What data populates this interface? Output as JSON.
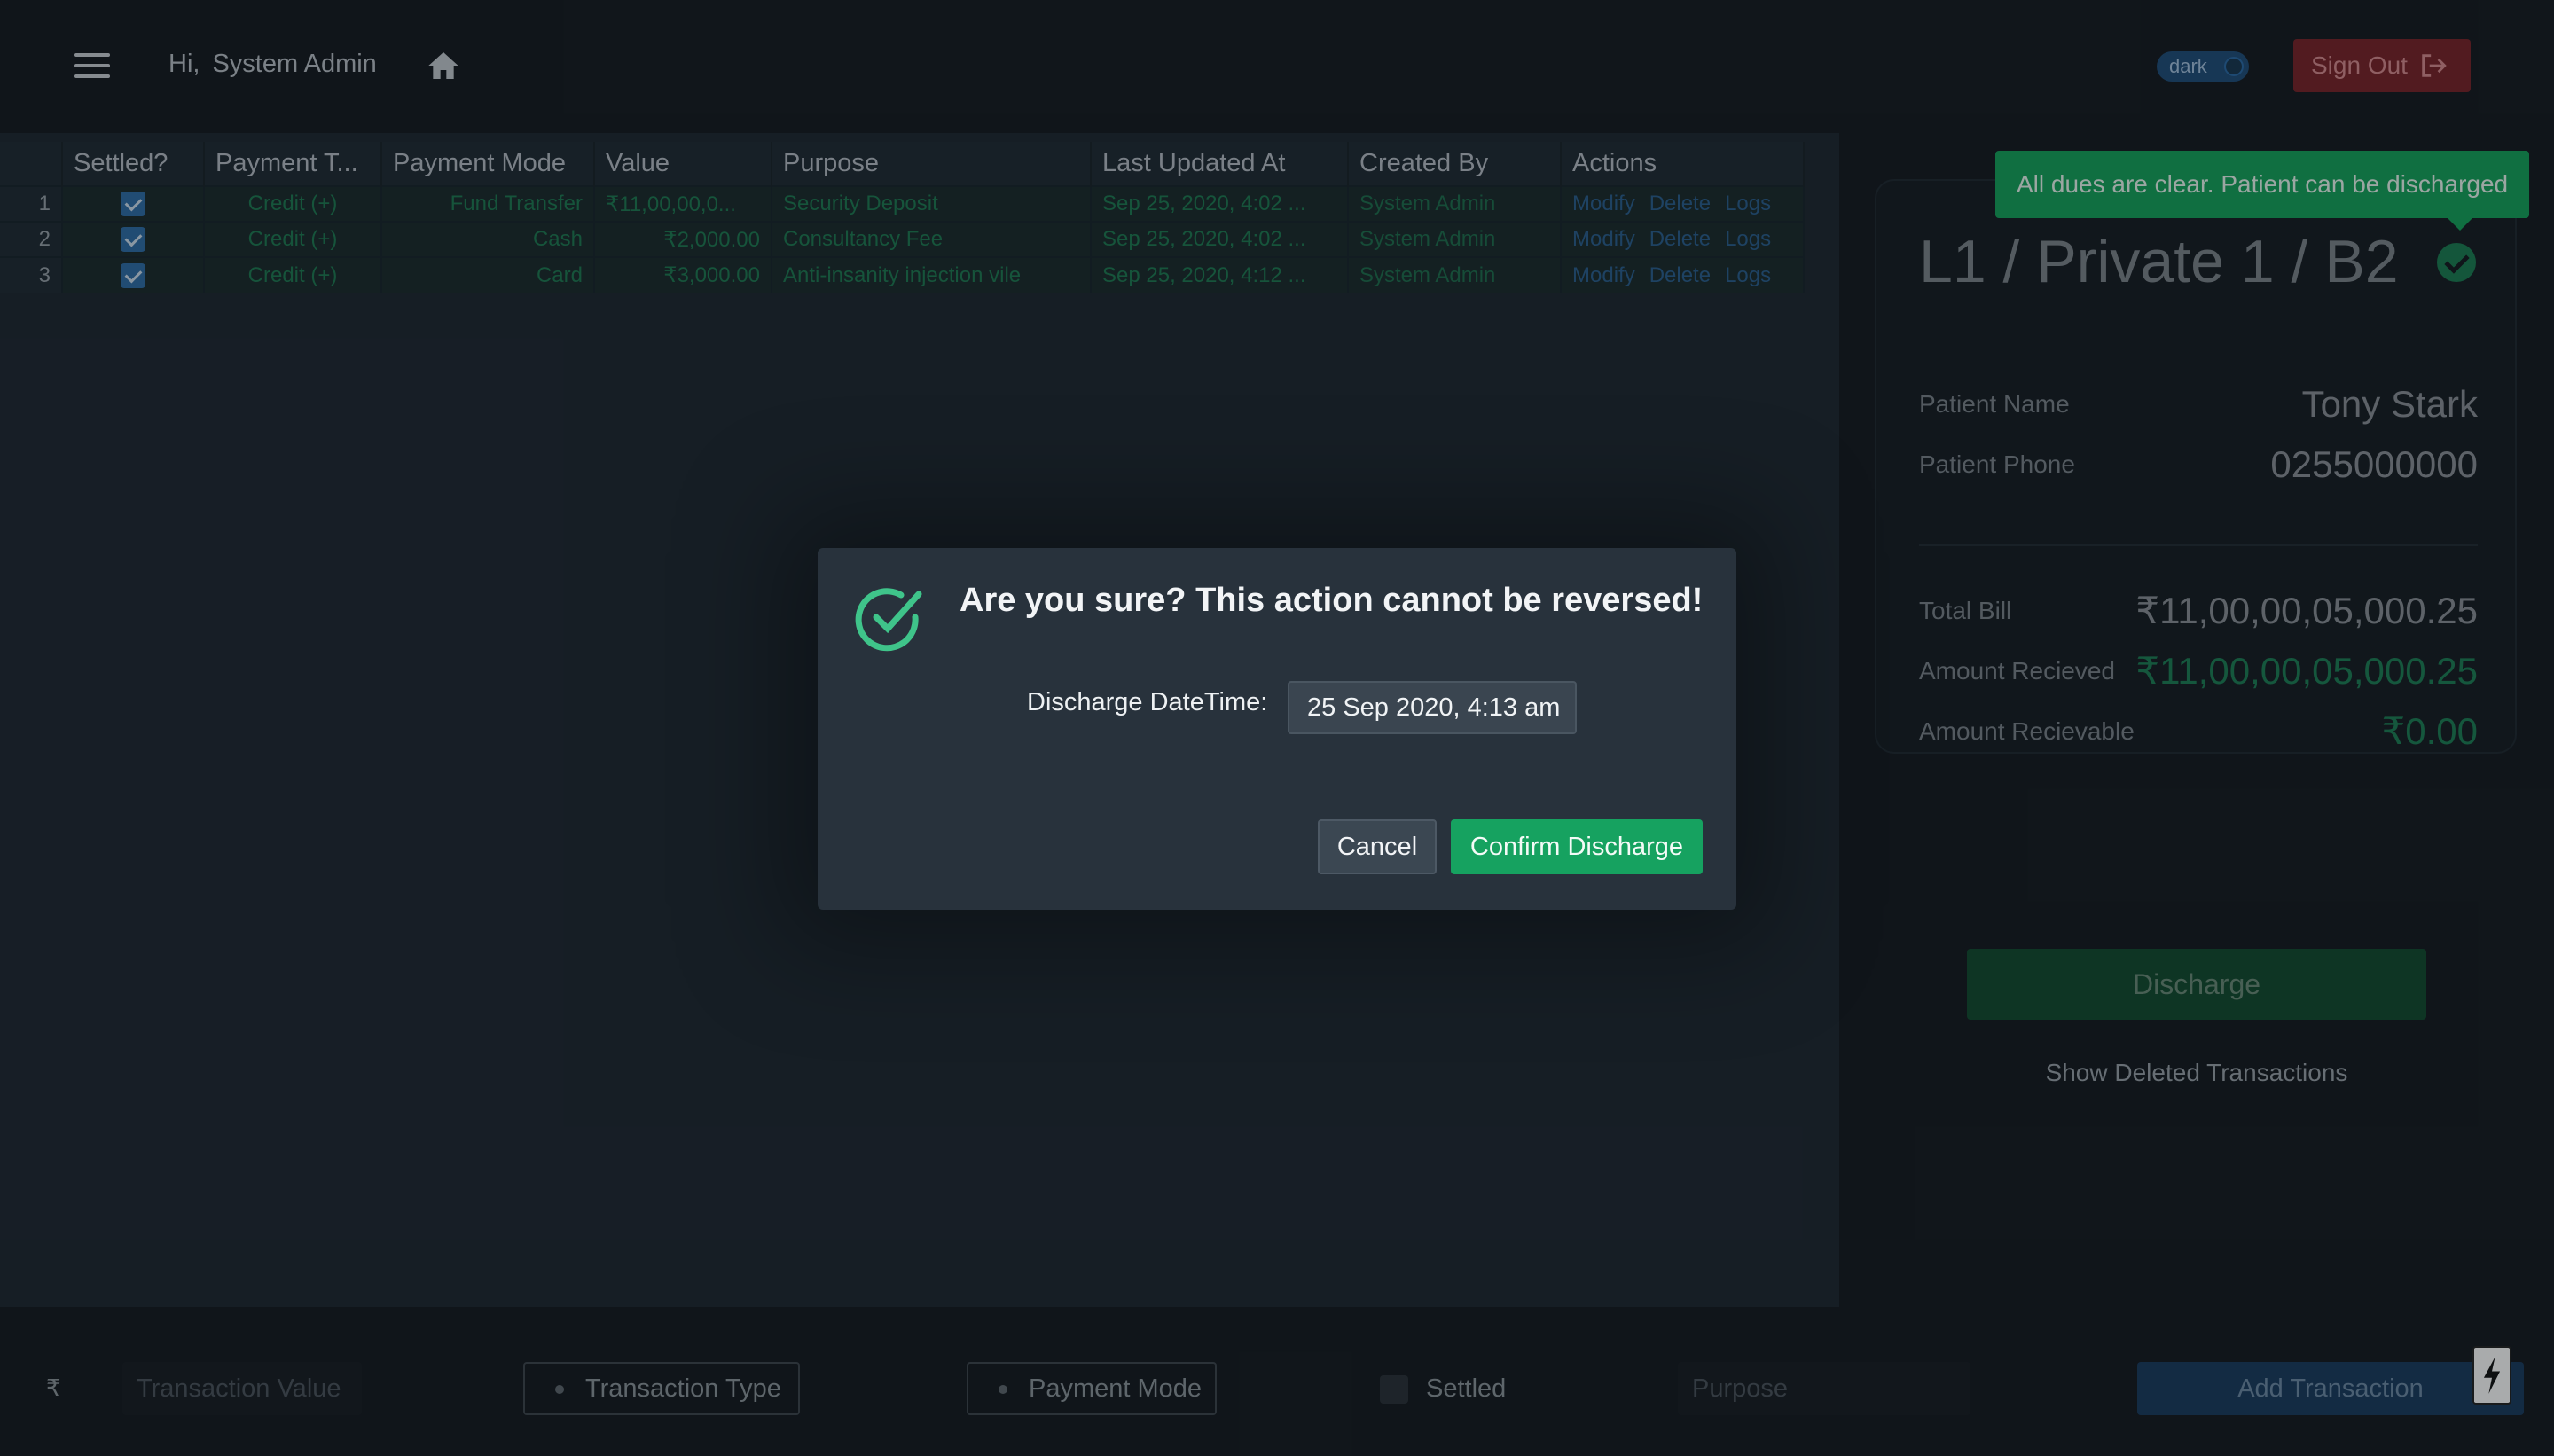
{
  "header": {
    "greeting": "Hi,",
    "user_name": "System Admin",
    "theme_label": "dark",
    "signout_label": "Sign Out"
  },
  "table": {
    "columns": [
      "",
      "Settled?",
      "Payment T...",
      "Payment Mode",
      "Value",
      "Purpose",
      "Last Updated At",
      "Created By",
      "Actions"
    ],
    "rows": [
      {
        "idx": "1",
        "type": "Credit (+)",
        "mode": "Fund Transfer",
        "value": "₹11,00,00,0...",
        "purpose": "Security Deposit",
        "updated": "Sep 25, 2020, 4:02 ...",
        "creator": "System Admin"
      },
      {
        "idx": "2",
        "type": "Credit (+)",
        "mode": "Cash",
        "value": "₹2,000.00",
        "purpose": "Consultancy Fee",
        "updated": "Sep 25, 2020, 4:02 ...",
        "creator": "System Admin"
      },
      {
        "idx": "3",
        "type": "Credit (+)",
        "mode": "Card",
        "value": "₹3,000.00",
        "purpose": "Anti-insanity injection vile",
        "updated": "Sep 25, 2020, 4:12 ...",
        "creator": "System Admin"
      }
    ],
    "actions": {
      "modify": "Modify",
      "delete": "Delete",
      "logs": "Logs"
    }
  },
  "summary": {
    "tooltip": "All dues are clear. Patient can be discharged",
    "room": "L1 / Private 1 / B2",
    "patient_name_label": "Patient Name",
    "patient_name": "Tony Stark",
    "patient_phone_label": "Patient Phone",
    "patient_phone": "0255000000",
    "total_bill_label": "Total Bill",
    "total_bill": "₹11,00,00,05,000.25",
    "amount_received_label": "Amount Recieved",
    "amount_received": "₹11,00,00,05,000.25",
    "amount_receivable_label": "Amount Recievable",
    "amount_receivable": "₹0.00",
    "discharge_label": "Discharge",
    "show_deleted_label": "Show Deleted Transactions"
  },
  "footer": {
    "currency": "₹",
    "value_placeholder": "Transaction Value",
    "type_label": "Transaction Type",
    "mode_label": "Payment Mode",
    "settled_label": "Settled",
    "purpose_placeholder": "Purpose",
    "add_label": "Add Transaction"
  },
  "modal": {
    "title": "Are you sure? This action cannot be reversed!",
    "datetime_label": "Discharge DateTime:",
    "datetime_value": "25 Sep 2020, 4:13 am",
    "cancel_label": "Cancel",
    "confirm_label": "Confirm Discharge"
  },
  "colors": {
    "accent_green": "#16a260",
    "danger": "#7a2328",
    "primary_blue": "#1a3b5f"
  }
}
